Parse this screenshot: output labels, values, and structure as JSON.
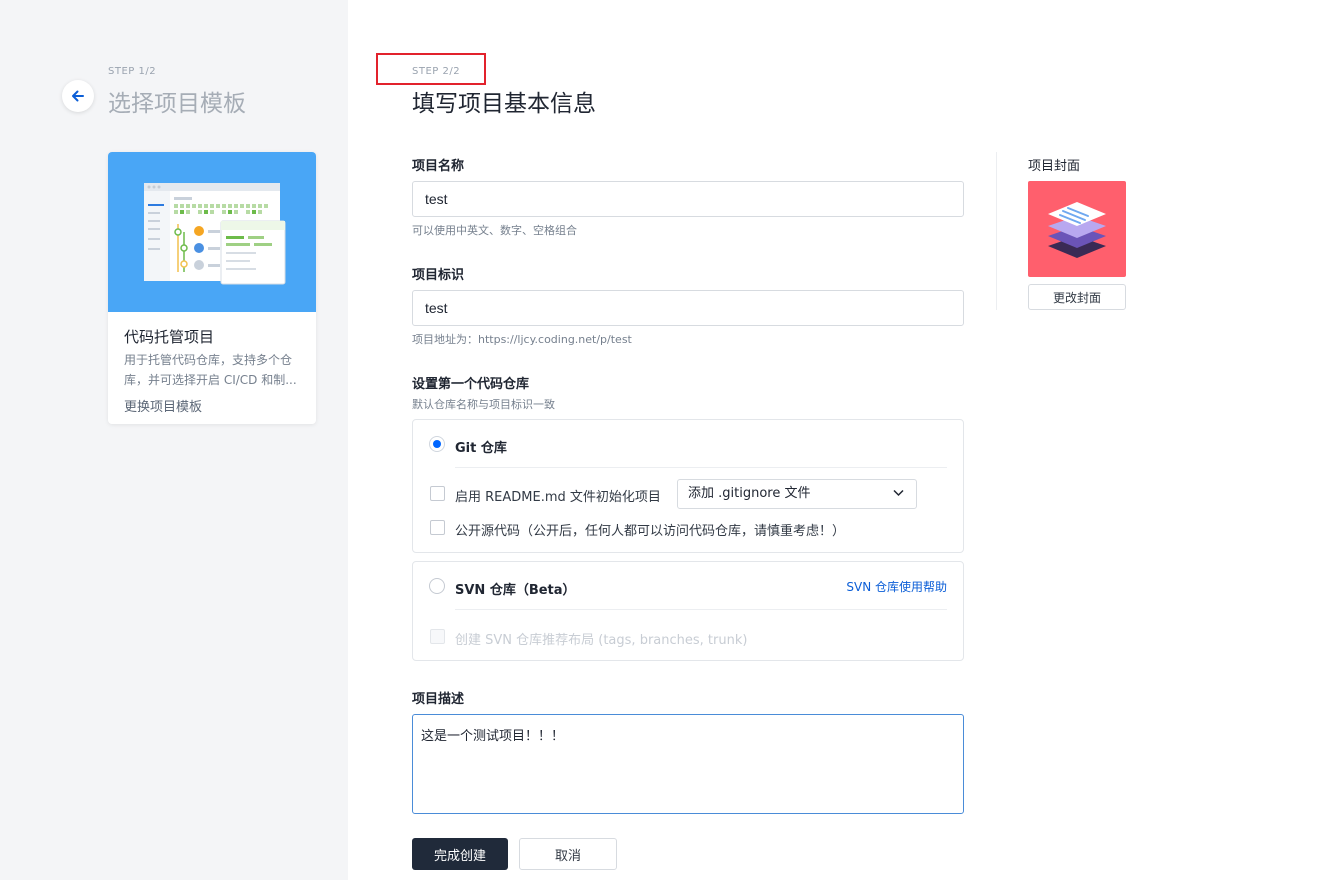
{
  "sidebar": {
    "step": "STEP 1/2",
    "title": "选择项目模板",
    "card": {
      "name": "代码托管项目",
      "description": "用于托管代码仓库，支持多个仓库，并可选择开启 CI/CD 和制...",
      "change_link": "更换项目模板"
    }
  },
  "main": {
    "step": "STEP 2/2",
    "title": "填写项目基本信息",
    "project_name": {
      "label": "项目名称",
      "value": "test",
      "hint": "可以使用中英文、数字、空格组合"
    },
    "project_id": {
      "label": "项目标识",
      "value": "test",
      "hint": "项目地址为：https://ljcy.coding.net/p/test"
    },
    "repo_section": {
      "label": "设置第一个代码仓库",
      "hint": "默认仓库名称与项目标识一致",
      "git": {
        "title": "Git 仓库",
        "readme_option": "启用 README.md 文件初始化项目",
        "gitignore_select": "添加 .gitignore 文件",
        "public_option": "公开源代码（公开后，任何人都可以访问代码仓库，请慎重考虑！）"
      },
      "svn": {
        "title": "SVN 仓库（Beta）",
        "help_link": "SVN 仓库使用帮助",
        "layout_option": "创建 SVN 仓库推荐布局 (tags, branches, trunk)"
      }
    },
    "description": {
      "label": "项目描述",
      "value": "这是一个测试项目！！！"
    },
    "buttons": {
      "submit": "完成创建",
      "cancel": "取消"
    }
  },
  "cover": {
    "label": "项目封面",
    "change_button": "更改封面",
    "color": "#ff5f6d"
  },
  "colors": {
    "primary_button": "#202a3a",
    "accent": "#0066ff",
    "highlight": "#e2222c"
  }
}
